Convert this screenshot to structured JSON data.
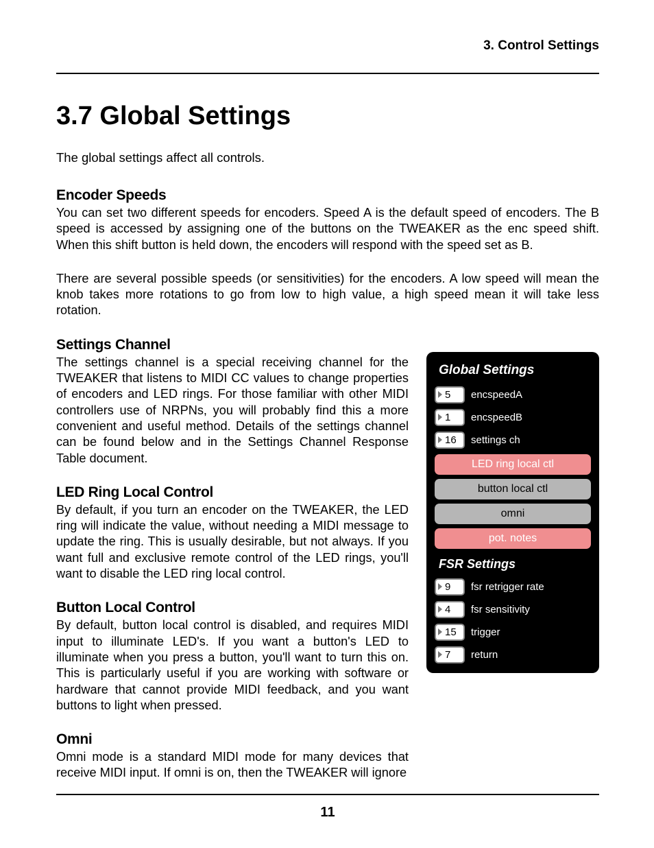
{
  "header": "3. Control Settings",
  "sectionTitle": "3.7   Global Settings",
  "intro": "The global settings affect all controls.",
  "encoderSpeeds": {
    "head": "Encoder Speeds",
    "p1": "You can set two different speeds for encoders. Speed A is the default speed of encoders. The B speed is accessed by assigning one of the buttons on the TWEAKER as the enc speed shift. When this shift button is held down, the encoders will respond with the speed set as B.",
    "p2": "There are several possible speeds (or sensitivities) for the encoders. A low speed will mean the knob takes more rotations to go from low to high value, a high speed mean it will take less rotation."
  },
  "settingsChannel": {
    "head": "Settings Channel",
    "p": "The settings channel is a special receiving channel for the TWEAKER that listens to MIDI CC values to change properties of encoders and LED rings. For those familiar with other MIDI controllers use of NRPNs, you will probably find this a more convenient and useful method. Details of the settings channel can be found below and in the Settings Channel Response Table document."
  },
  "ledRing": {
    "head": "LED Ring Local Control",
    "p": "By default, if you turn an encoder on the TWEAKER, the LED ring will indicate the value, without needing a MIDI message to update the ring. This is usually desirable, but not always. If you want full and exclusive remote control of the LED rings, you'll want to disable the LED ring local control."
  },
  "buttonLocal": {
    "head": "Button Local Control",
    "p": "By default, button local control is disabled, and requires MIDI input to illuminate LED's. If you want a button's LED to illuminate when you press a button, you'll want to turn this on. This is particularly useful if you are working with software or hardware that cannot provide MIDI feedback, and you want buttons to light when pressed."
  },
  "omni": {
    "head": "Omni",
    "p": "Omni mode is a standard MIDI mode for many devices that receive MIDI input. If omni is on, then the TWEAKER will ignore"
  },
  "panel": {
    "title": "Global Settings",
    "rows": [
      {
        "value": "5",
        "label": "encspeedA"
      },
      {
        "value": "1",
        "label": "encspeedB"
      },
      {
        "value": "16",
        "label": "settings ch"
      }
    ],
    "toggles": [
      {
        "label": "LED ring local ctl",
        "on": true
      },
      {
        "label": "button local ctl",
        "on": false
      },
      {
        "label": "omni",
        "on": false
      },
      {
        "label": "pot. notes",
        "on": true
      }
    ],
    "fsrTitle": "FSR Settings",
    "fsrRows": [
      {
        "value": "9",
        "label": "fsr retrigger rate"
      },
      {
        "value": "4",
        "label": "fsr sensitivity"
      },
      {
        "value": "15",
        "label": "trigger"
      },
      {
        "value": "7",
        "label": "return"
      }
    ]
  },
  "pageNumber": "11"
}
